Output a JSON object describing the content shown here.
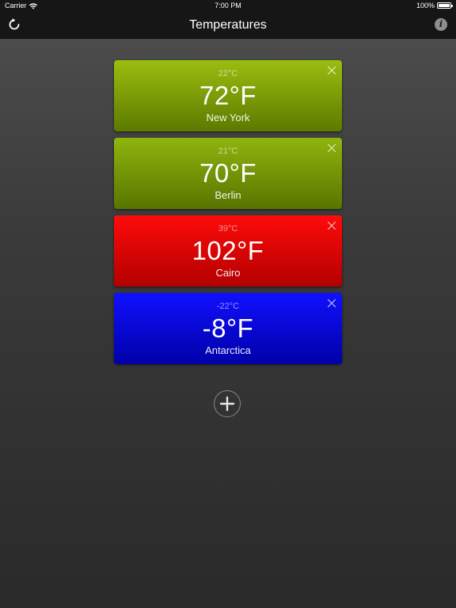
{
  "status_bar": {
    "carrier": "Carrier",
    "time": "7:00 PM",
    "battery": "100%",
    "battery_level": 1.0
  },
  "nav": {
    "title": "Temperatures",
    "left_icon": "refresh-icon",
    "right_icon": "info-icon",
    "info_glyph": "i"
  },
  "cards": [
    {
      "celsius": "22°C",
      "fahrenheit": "72°F",
      "city": "New York",
      "color_top": "#9bbd0f",
      "color_bottom": "#5c7a00"
    },
    {
      "celsius": "21°C",
      "fahrenheit": "70°F",
      "city": "Berlin",
      "color_top": "#8fb50d",
      "color_bottom": "#587400"
    },
    {
      "celsius": "39°C",
      "fahrenheit": "102°F",
      "city": "Cairo",
      "color_top": "#ff0a0a",
      "color_bottom": "#b30000"
    },
    {
      "celsius": "-22°C",
      "fahrenheit": "-8°F",
      "city": "Antarctica",
      "color_top": "#1010ff",
      "color_bottom": "#0000a8"
    }
  ],
  "add_icon": "plus-icon"
}
